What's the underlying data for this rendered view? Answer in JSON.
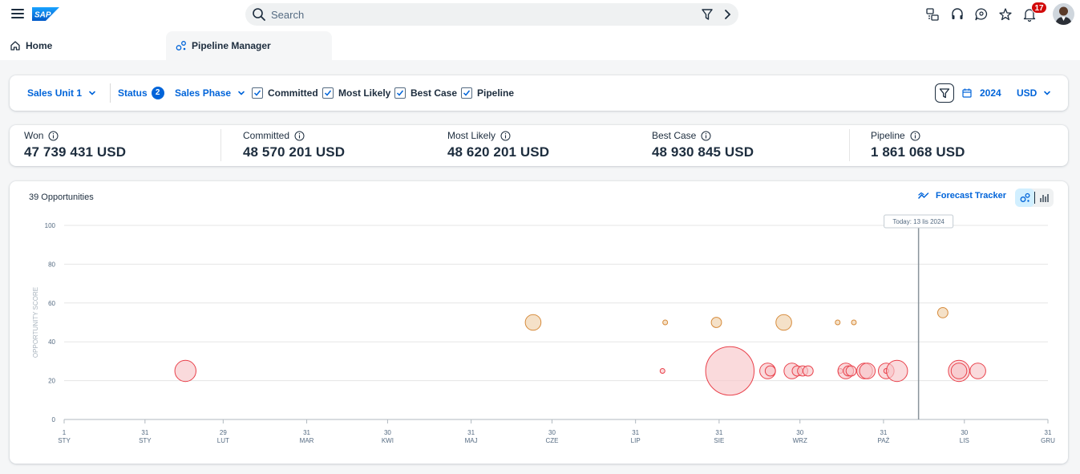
{
  "shell": {
    "search_placeholder": "Search",
    "notification_count": "17"
  },
  "tabs": [
    {
      "label": "Home"
    },
    {
      "label": "Pipeline Manager"
    }
  ],
  "filters": {
    "sales_unit": "Sales Unit 1",
    "status_label": "Status",
    "status_count": "2",
    "sales_phase": "Sales Phase",
    "checkboxes": [
      {
        "label": "Committed",
        "checked": true
      },
      {
        "label": "Most Likely",
        "checked": true
      },
      {
        "label": "Best Case",
        "checked": true
      },
      {
        "label": "Pipeline",
        "checked": true
      }
    ],
    "year": "2024",
    "currency": "USD"
  },
  "kpis": [
    {
      "label": "Won",
      "value": "47 739 431 USD"
    },
    {
      "label": "Committed",
      "value": "48 570 201 USD"
    },
    {
      "label": "Most Likely",
      "value": "48 620 201 USD"
    },
    {
      "label": "Best Case",
      "value": "48 930 845 USD"
    },
    {
      "label": "Pipeline",
      "value": "1 861 068 USD"
    }
  ],
  "chart_header": {
    "opportunities": "39 Opportunities",
    "forecast_tracker": "Forecast Tracker"
  },
  "colors": {
    "accent": "#0064d9",
    "red_fill": "#f8c6c9",
    "red_stroke": "#e9404a",
    "orange_fill": "#f3dcbe",
    "orange_stroke": "#d68a3a",
    "badge": "#d20a0a"
  },
  "chart_data": {
    "type": "scatter",
    "title": "",
    "xlabel": "",
    "ylabel": "OPPORTUNITY SCORE",
    "ylim": [
      0,
      100
    ],
    "yticks": [
      0,
      20,
      40,
      60,
      80,
      100
    ],
    "xlim": [
      "2024-01-01",
      "2024-12-31"
    ],
    "xticks": [
      {
        "date": "2024-01-01",
        "day": "1",
        "month": "STY"
      },
      {
        "date": "2024-01-31",
        "day": "31",
        "month": "STY"
      },
      {
        "date": "2024-02-29",
        "day": "29",
        "month": "LUT"
      },
      {
        "date": "2024-03-31",
        "day": "31",
        "month": "MAR"
      },
      {
        "date": "2024-04-30",
        "day": "30",
        "month": "KWI"
      },
      {
        "date": "2024-05-31",
        "day": "31",
        "month": "MAJ"
      },
      {
        "date": "2024-06-30",
        "day": "30",
        "month": "CZE"
      },
      {
        "date": "2024-07-31",
        "day": "31",
        "month": "LIP"
      },
      {
        "date": "2024-08-31",
        "day": "31",
        "month": "SIE"
      },
      {
        "date": "2024-09-30",
        "day": "30",
        "month": "WRZ"
      },
      {
        "date": "2024-10-31",
        "day": "31",
        "month": "PAŹ"
      },
      {
        "date": "2024-11-30",
        "day": "30",
        "month": "LIS"
      },
      {
        "date": "2024-12-31",
        "day": "31",
        "month": "GRU"
      }
    ],
    "today_label": "Today: 13 lis 2024",
    "today_date": "2024-11-13",
    "grid": "horizontal",
    "series": [
      {
        "color": "red",
        "points": [
          {
            "date": "2024-02-15",
            "y": 25,
            "size": 4
          },
          {
            "date": "2024-08-10",
            "y": 25,
            "size": 1
          },
          {
            "date": "2024-09-04",
            "y": 25,
            "size": 9
          },
          {
            "date": "2024-09-18",
            "y": 25,
            "size": 3
          },
          {
            "date": "2024-09-19",
            "y": 25,
            "size": 2
          },
          {
            "date": "2024-09-27",
            "y": 25,
            "size": 3
          },
          {
            "date": "2024-09-29",
            "y": 25,
            "size": 2
          },
          {
            "date": "2024-10-01",
            "y": 25,
            "size": 2
          },
          {
            "date": "2024-10-03",
            "y": 25,
            "size": 2
          },
          {
            "date": "2024-10-15",
            "y": 25,
            "size": 1
          },
          {
            "date": "2024-10-17",
            "y": 25,
            "size": 3
          },
          {
            "date": "2024-10-18",
            "y": 25,
            "size": 2
          },
          {
            "date": "2024-10-19",
            "y": 25,
            "size": 2
          },
          {
            "date": "2024-10-24",
            "y": 25,
            "size": 3
          },
          {
            "date": "2024-10-25",
            "y": 25,
            "size": 3
          },
          {
            "date": "2024-11-01",
            "y": 25,
            "size": 3
          },
          {
            "date": "2024-11-01",
            "y": 25,
            "size": 1
          },
          {
            "date": "2024-11-05",
            "y": 25,
            "size": 4
          },
          {
            "date": "2024-11-28",
            "y": 25,
            "size": 4
          },
          {
            "date": "2024-11-28",
            "y": 25,
            "size": 3
          },
          {
            "date": "2024-12-05",
            "y": 25,
            "size": 3
          }
        ]
      },
      {
        "color": "orange",
        "points": [
          {
            "date": "2024-06-23",
            "y": 50,
            "size": 3
          },
          {
            "date": "2024-08-11",
            "y": 50,
            "size": 1
          },
          {
            "date": "2024-08-30",
            "y": 50,
            "size": 2
          },
          {
            "date": "2024-09-24",
            "y": 50,
            "size": 3
          },
          {
            "date": "2024-10-14",
            "y": 50,
            "size": 1
          },
          {
            "date": "2024-10-20",
            "y": 50,
            "size": 1
          },
          {
            "date": "2024-11-22",
            "y": 55,
            "size": 2
          }
        ]
      }
    ]
  }
}
